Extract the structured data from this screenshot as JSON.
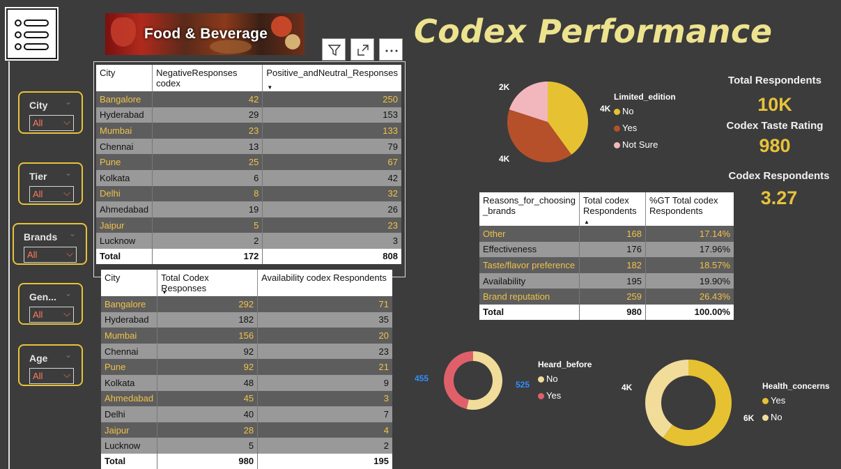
{
  "banner": {
    "text": "Food & Beverage"
  },
  "title": "Codex Performance",
  "slicers": [
    {
      "label": "City",
      "value": "All"
    },
    {
      "label": "Tier",
      "value": "All"
    },
    {
      "label": "Brands",
      "value": "All"
    },
    {
      "label": "Gen...",
      "value": "All"
    },
    {
      "label": "Age",
      "value": "All"
    }
  ],
  "table1": {
    "headers": [
      "City",
      "NegativeResponses codex",
      "Positive_andNeutral_Responses"
    ],
    "rows": [
      [
        "Bangalore",
        "42",
        "250"
      ],
      [
        "Hyderabad",
        "29",
        "153"
      ],
      [
        "Mumbai",
        "23",
        "133"
      ],
      [
        "Chennai",
        "13",
        "79"
      ],
      [
        "Pune",
        "25",
        "67"
      ],
      [
        "Kolkata",
        "6",
        "42"
      ],
      [
        "Delhi",
        "8",
        "32"
      ],
      [
        "Ahmedabad",
        "19",
        "26"
      ],
      [
        "Jaipur",
        "5",
        "23"
      ],
      [
        "Lucknow",
        "2",
        "3"
      ]
    ],
    "total": [
      "Total",
      "172",
      "808"
    ]
  },
  "table2": {
    "headers": [
      "City",
      "Total Codex Responses",
      "Availability codex Respondents"
    ],
    "rows": [
      [
        "Bangalore",
        "292",
        "71"
      ],
      [
        "Hyderabad",
        "182",
        "35"
      ],
      [
        "Mumbai",
        "156",
        "20"
      ],
      [
        "Chennai",
        "92",
        "23"
      ],
      [
        "Pune",
        "92",
        "21"
      ],
      [
        "Kolkata",
        "48",
        "9"
      ],
      [
        "Ahmedabad",
        "45",
        "3"
      ],
      [
        "Delhi",
        "40",
        "7"
      ],
      [
        "Jaipur",
        "28",
        "4"
      ],
      [
        "Lucknow",
        "5",
        "2"
      ]
    ],
    "total": [
      "Total",
      "980",
      "195"
    ]
  },
  "table3": {
    "headers": [
      "Reasons_for_choosing _brands",
      "Total codex Respondents",
      "%GT Total codex Respondents"
    ],
    "rows": [
      [
        "Other",
        "168",
        "17.14%"
      ],
      [
        "Effectiveness",
        "176",
        "17.96%"
      ],
      [
        "Taste/flavor preference",
        "182",
        "18.57%"
      ],
      [
        "Availability",
        "195",
        "19.90%"
      ],
      [
        "Brand reputation",
        "259",
        "26.43%"
      ]
    ],
    "total": [
      "Total",
      "980",
      "100.00%"
    ]
  },
  "kpis": {
    "total_respondents_label": "Total Respondents",
    "total_respondents_value": "10K",
    "taste_rating_label": "Codex Taste Rating",
    "taste_rating_value": "980",
    "codex_respondents_label": "Codex Respondents",
    "codex_respondents_value": "3.27"
  },
  "chart_data": [
    {
      "type": "pie",
      "legend_title": "Limited_edition",
      "categories": [
        "No",
        "Yes",
        "Not Sure"
      ],
      "values": [
        4,
        4,
        2
      ],
      "data_labels": [
        "4K",
        "4K",
        "2K"
      ],
      "colors": [
        "#e6c232",
        "#b5502a",
        "#f2b7bc"
      ],
      "legend": "right"
    },
    {
      "type": "pie",
      "subtype": "donut",
      "legend_title": "Heard_before",
      "categories": [
        "No",
        "Yes"
      ],
      "values": [
        525,
        455
      ],
      "data_labels": [
        "525",
        "455"
      ],
      "colors": [
        "#f1dc9a",
        "#e0606a"
      ],
      "legend": "right"
    },
    {
      "type": "pie",
      "subtype": "donut",
      "legend_title": "Health_concerns",
      "categories": [
        "Yes",
        "No"
      ],
      "values": [
        6,
        4
      ],
      "data_labels": [
        "6K",
        "4K"
      ],
      "colors": [
        "#e6c232",
        "#f1dc9a"
      ],
      "legend": "right"
    }
  ],
  "icons": {
    "menu": "menu-icon",
    "filter": "filter-icon",
    "focus": "focus-mode-icon",
    "more": "more-options-icon"
  }
}
